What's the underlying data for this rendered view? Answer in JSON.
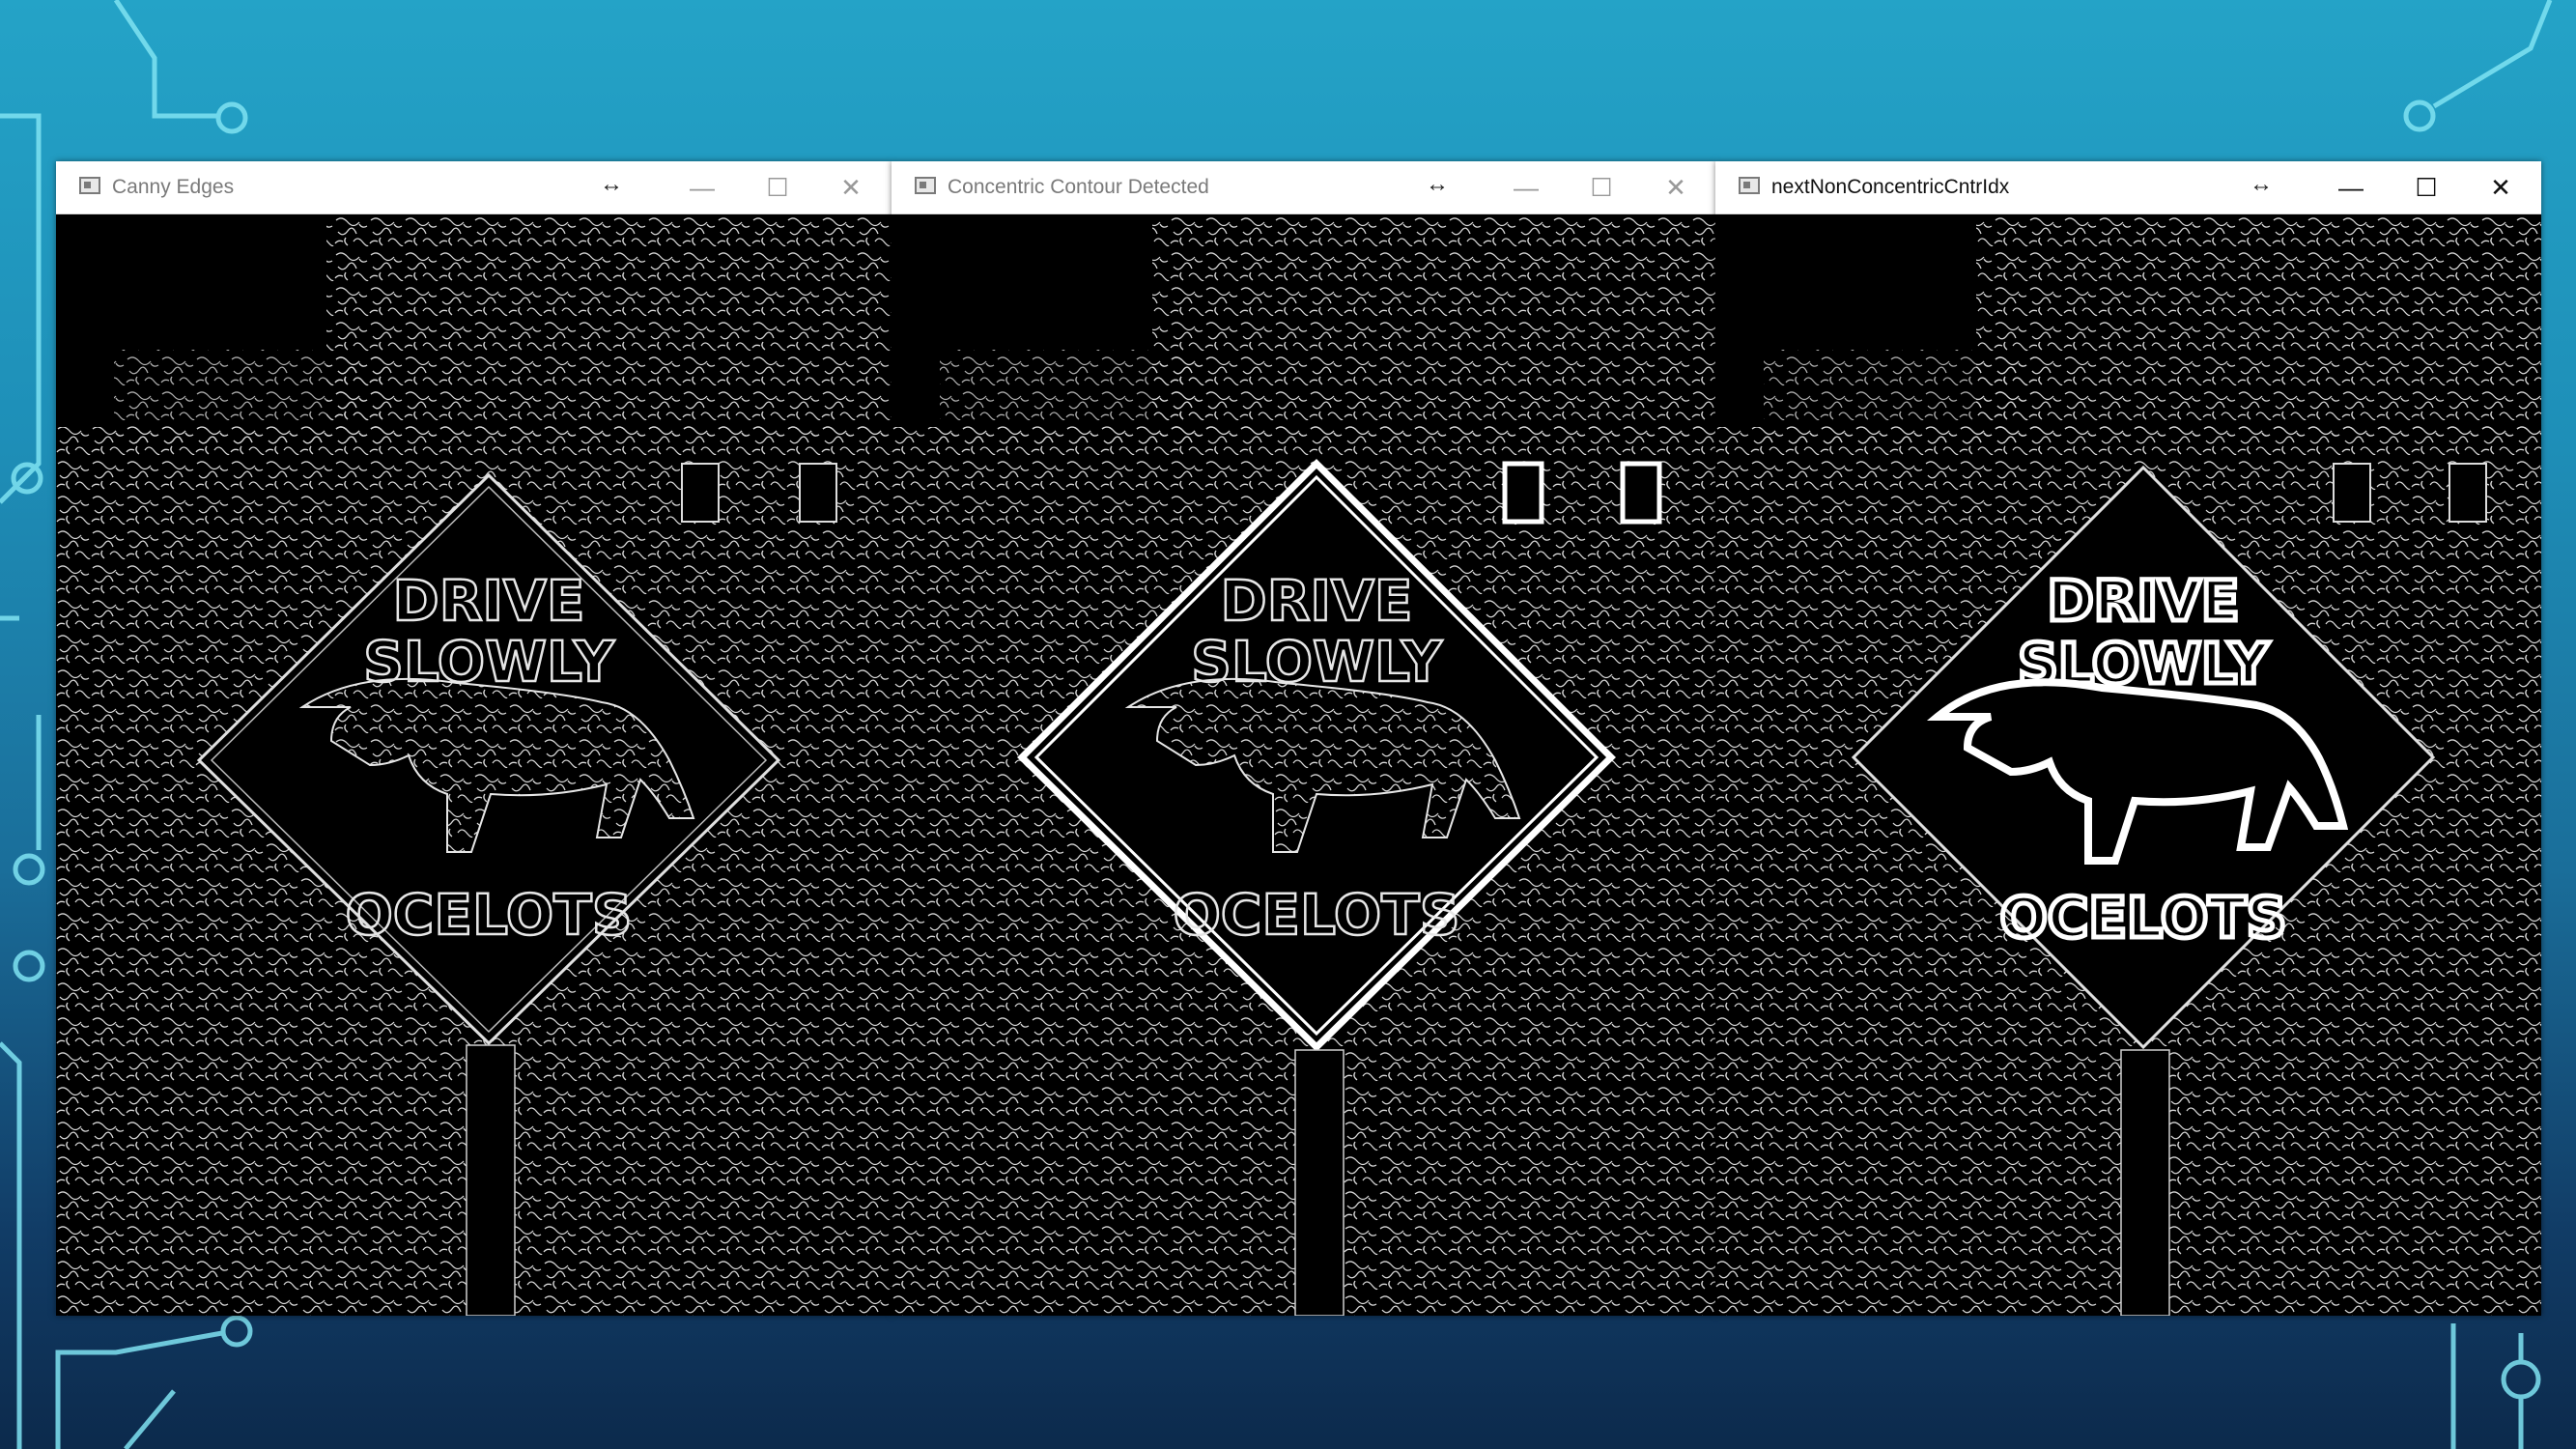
{
  "windows": [
    {
      "title": "Canny Edges",
      "active": false
    },
    {
      "title": "Concentric Contour Detected",
      "active": false
    },
    {
      "title": "nextNonConcentricCntrIdx",
      "active": true
    }
  ],
  "sign": {
    "line1": "DRIVE",
    "line2": "SLOWLY",
    "line3": "OCELOTS"
  },
  "controls": {
    "resize": "↔",
    "minimize": "—",
    "maximize": "☐",
    "close": "✕"
  },
  "colors": {
    "background_top": "#24a3c7",
    "background_bottom": "#0c2a4c",
    "circuit_line": "#7fe3f2",
    "edge_white": "#ffffff"
  }
}
